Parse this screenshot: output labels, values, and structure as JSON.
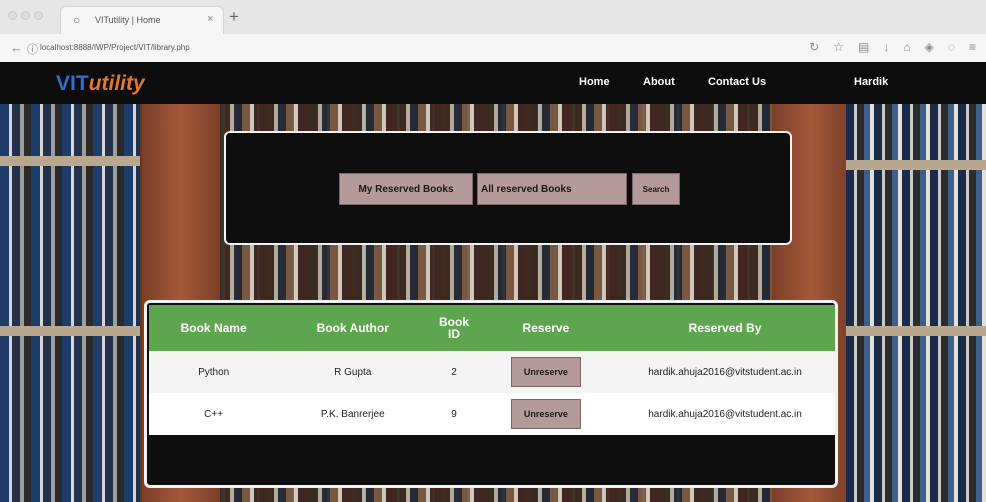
{
  "browser": {
    "tab_title": "VITutility | Home",
    "url": "localhost:8888/IWP/Project/VIT/library.php",
    "back_icon": "back-arrow-icon"
  },
  "header": {
    "logo_main": "VIT",
    "logo_accent": "utility",
    "nav": [
      {
        "label": "Home"
      },
      {
        "label": "About"
      },
      {
        "label": "Contact Us"
      },
      {
        "label": "Hardik"
      }
    ]
  },
  "search": {
    "my_reserved_label": "My Reserved Books",
    "input_value": "All reserved Books",
    "search_label": "Search"
  },
  "table": {
    "columns": [
      "Book Name",
      "Book Author",
      "Book ID",
      "Reserve",
      "Reserved By"
    ],
    "rows": [
      {
        "name": "Python",
        "author": "R Gupta",
        "id": "2",
        "action": "Unreserve",
        "reserved_by": "hardik.ahuja2016@vitstudent.ac.in"
      },
      {
        "name": "C++",
        "author": "P.K. Banrerjee",
        "id": "9",
        "action": "Unreserve",
        "reserved_by": "hardik.ahuja2016@vitstudent.ac.in"
      }
    ]
  },
  "colors": {
    "header_bg": "#0c0c0c",
    "table_header": "#5ea54f",
    "button_bg": "#b49a9b",
    "logo_blue": "#2e6fd0",
    "logo_orange": "#e07a2a"
  }
}
